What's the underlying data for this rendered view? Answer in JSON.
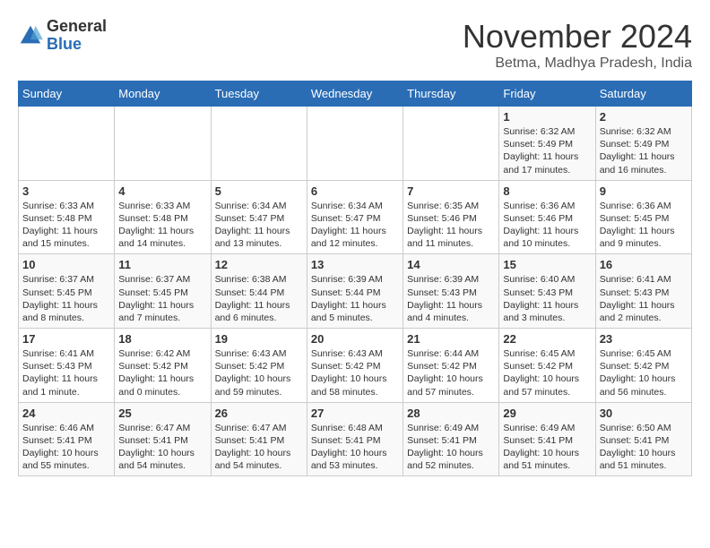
{
  "logo": {
    "general": "General",
    "blue": "Blue"
  },
  "title": "November 2024",
  "location": "Betma, Madhya Pradesh, India",
  "weekdays": [
    "Sunday",
    "Monday",
    "Tuesday",
    "Wednesday",
    "Thursday",
    "Friday",
    "Saturday"
  ],
  "weeks": [
    [
      {
        "day": "",
        "info": ""
      },
      {
        "day": "",
        "info": ""
      },
      {
        "day": "",
        "info": ""
      },
      {
        "day": "",
        "info": ""
      },
      {
        "day": "",
        "info": ""
      },
      {
        "day": "1",
        "info": "Sunrise: 6:32 AM\nSunset: 5:49 PM\nDaylight: 11 hours and 17 minutes."
      },
      {
        "day": "2",
        "info": "Sunrise: 6:32 AM\nSunset: 5:49 PM\nDaylight: 11 hours and 16 minutes."
      }
    ],
    [
      {
        "day": "3",
        "info": "Sunrise: 6:33 AM\nSunset: 5:48 PM\nDaylight: 11 hours and 15 minutes."
      },
      {
        "day": "4",
        "info": "Sunrise: 6:33 AM\nSunset: 5:48 PM\nDaylight: 11 hours and 14 minutes."
      },
      {
        "day": "5",
        "info": "Sunrise: 6:34 AM\nSunset: 5:47 PM\nDaylight: 11 hours and 13 minutes."
      },
      {
        "day": "6",
        "info": "Sunrise: 6:34 AM\nSunset: 5:47 PM\nDaylight: 11 hours and 12 minutes."
      },
      {
        "day": "7",
        "info": "Sunrise: 6:35 AM\nSunset: 5:46 PM\nDaylight: 11 hours and 11 minutes."
      },
      {
        "day": "8",
        "info": "Sunrise: 6:36 AM\nSunset: 5:46 PM\nDaylight: 11 hours and 10 minutes."
      },
      {
        "day": "9",
        "info": "Sunrise: 6:36 AM\nSunset: 5:45 PM\nDaylight: 11 hours and 9 minutes."
      }
    ],
    [
      {
        "day": "10",
        "info": "Sunrise: 6:37 AM\nSunset: 5:45 PM\nDaylight: 11 hours and 8 minutes."
      },
      {
        "day": "11",
        "info": "Sunrise: 6:37 AM\nSunset: 5:45 PM\nDaylight: 11 hours and 7 minutes."
      },
      {
        "day": "12",
        "info": "Sunrise: 6:38 AM\nSunset: 5:44 PM\nDaylight: 11 hours and 6 minutes."
      },
      {
        "day": "13",
        "info": "Sunrise: 6:39 AM\nSunset: 5:44 PM\nDaylight: 11 hours and 5 minutes."
      },
      {
        "day": "14",
        "info": "Sunrise: 6:39 AM\nSunset: 5:43 PM\nDaylight: 11 hours and 4 minutes."
      },
      {
        "day": "15",
        "info": "Sunrise: 6:40 AM\nSunset: 5:43 PM\nDaylight: 11 hours and 3 minutes."
      },
      {
        "day": "16",
        "info": "Sunrise: 6:41 AM\nSunset: 5:43 PM\nDaylight: 11 hours and 2 minutes."
      }
    ],
    [
      {
        "day": "17",
        "info": "Sunrise: 6:41 AM\nSunset: 5:43 PM\nDaylight: 11 hours and 1 minute."
      },
      {
        "day": "18",
        "info": "Sunrise: 6:42 AM\nSunset: 5:42 PM\nDaylight: 11 hours and 0 minutes."
      },
      {
        "day": "19",
        "info": "Sunrise: 6:43 AM\nSunset: 5:42 PM\nDaylight: 10 hours and 59 minutes."
      },
      {
        "day": "20",
        "info": "Sunrise: 6:43 AM\nSunset: 5:42 PM\nDaylight: 10 hours and 58 minutes."
      },
      {
        "day": "21",
        "info": "Sunrise: 6:44 AM\nSunset: 5:42 PM\nDaylight: 10 hours and 57 minutes."
      },
      {
        "day": "22",
        "info": "Sunrise: 6:45 AM\nSunset: 5:42 PM\nDaylight: 10 hours and 57 minutes."
      },
      {
        "day": "23",
        "info": "Sunrise: 6:45 AM\nSunset: 5:42 PM\nDaylight: 10 hours and 56 minutes."
      }
    ],
    [
      {
        "day": "24",
        "info": "Sunrise: 6:46 AM\nSunset: 5:41 PM\nDaylight: 10 hours and 55 minutes."
      },
      {
        "day": "25",
        "info": "Sunrise: 6:47 AM\nSunset: 5:41 PM\nDaylight: 10 hours and 54 minutes."
      },
      {
        "day": "26",
        "info": "Sunrise: 6:47 AM\nSunset: 5:41 PM\nDaylight: 10 hours and 54 minutes."
      },
      {
        "day": "27",
        "info": "Sunrise: 6:48 AM\nSunset: 5:41 PM\nDaylight: 10 hours and 53 minutes."
      },
      {
        "day": "28",
        "info": "Sunrise: 6:49 AM\nSunset: 5:41 PM\nDaylight: 10 hours and 52 minutes."
      },
      {
        "day": "29",
        "info": "Sunrise: 6:49 AM\nSunset: 5:41 PM\nDaylight: 10 hours and 51 minutes."
      },
      {
        "day": "30",
        "info": "Sunrise: 6:50 AM\nSunset: 5:41 PM\nDaylight: 10 hours and 51 minutes."
      }
    ]
  ]
}
